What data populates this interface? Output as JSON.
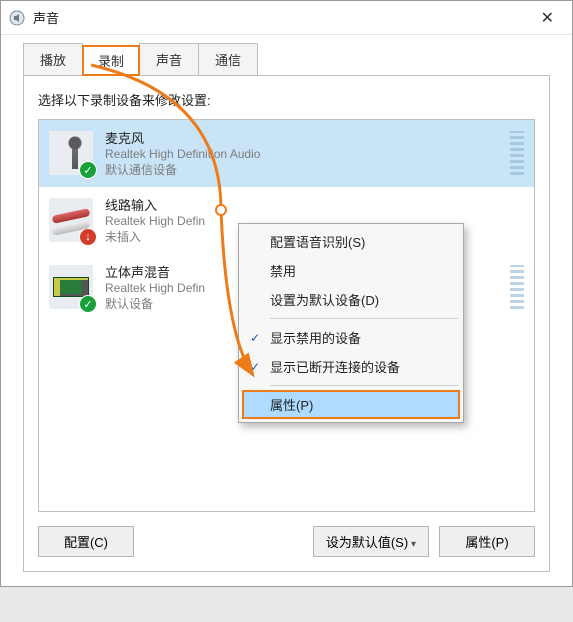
{
  "window": {
    "title": "声音"
  },
  "tabs": {
    "playback": "播放",
    "recording": "录制",
    "sounds": "声音",
    "comm": "通信"
  },
  "instr": "选择以下录制设备来修改设置:",
  "devices": [
    {
      "name": "麦克风",
      "desc": "Realtek High Definition Audio",
      "status": "默认通信设备"
    },
    {
      "name": "线路输入",
      "desc": "Realtek High Defin",
      "status": "未插入"
    },
    {
      "name": "立体声混音",
      "desc": "Realtek High Defin",
      "status": "默认设备"
    }
  ],
  "context_menu": {
    "configure_speech": "配置语音识别(S)",
    "disable": "禁用",
    "set_default": "设置为默认设备(D)",
    "show_disabled": "显示禁用的设备",
    "show_disconnected": "显示已断开连接的设备",
    "properties": "属性(P)"
  },
  "footer": {
    "configure": "配置(C)",
    "set_default": "设为默认值(S)",
    "properties": "属性(P)"
  },
  "icons": {
    "check": "✓",
    "down_red": "↓",
    "close": "✕"
  }
}
